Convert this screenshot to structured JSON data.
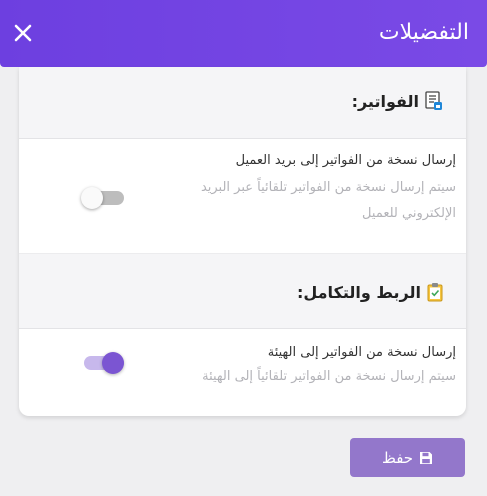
{
  "header": {
    "title": "التفضيلات"
  },
  "sections": [
    {
      "title": "الفواتير:",
      "icon": "invoice-icon",
      "settings": [
        {
          "title": "إرسال نسخة من الفواتير إلى بريد العميل",
          "description": "سيتم إرسال نسخة من الفواتير تلقائياً عبر البريد الإلكتروني للعميل",
          "enabled": false
        }
      ]
    },
    {
      "title": "الربط والتكامل:",
      "icon": "clipboard-check-icon",
      "settings": [
        {
          "title": "إرسال نسخة من الفواتير إلى الهيئة",
          "description": "سيتم إرسال نسخة من الفواتير تلقائياً إلى الهيئة",
          "enabled": true
        }
      ]
    }
  ],
  "footer": {
    "save_label": "حفظ",
    "save_icon": "floppy-disk-icon"
  },
  "colors": {
    "header": "#6d3fe0",
    "accent": "#7b55d2",
    "save_button": "#9377cb",
    "toggle_on_track": "#c7b8ec",
    "toggle_off_track": "#bdbdbd"
  }
}
